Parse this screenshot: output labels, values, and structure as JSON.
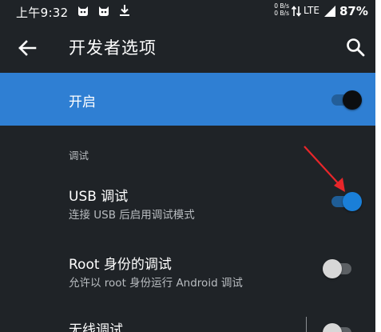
{
  "status_bar": {
    "time": "上午9:32",
    "net_up": "0 B/s",
    "net_down": "0 B/s",
    "network": "LTE",
    "battery": "87%"
  },
  "toolbar": {
    "title": "开发者选项"
  },
  "master_switch": {
    "label": "开启",
    "checked": true
  },
  "section": {
    "header": "调试"
  },
  "items": [
    {
      "title": "USB 调试",
      "summary": "连接 USB 后启用调试模式",
      "checked": true
    },
    {
      "title": "Root 身份的调试",
      "summary": "允许以 root 身份运行 Android 调试",
      "checked": false
    },
    {
      "title": "无线调试",
      "summary": "",
      "checked": false
    }
  ],
  "colors": {
    "background": "#1f2327",
    "accent": "#2f7fd3",
    "annotation_arrow": "#e8262a"
  },
  "icons": [
    "cat-face-icon",
    "cat-face-icon",
    "download-icon",
    "network-arrows-icon",
    "signal-icon",
    "back-arrow-icon",
    "search-icon"
  ]
}
